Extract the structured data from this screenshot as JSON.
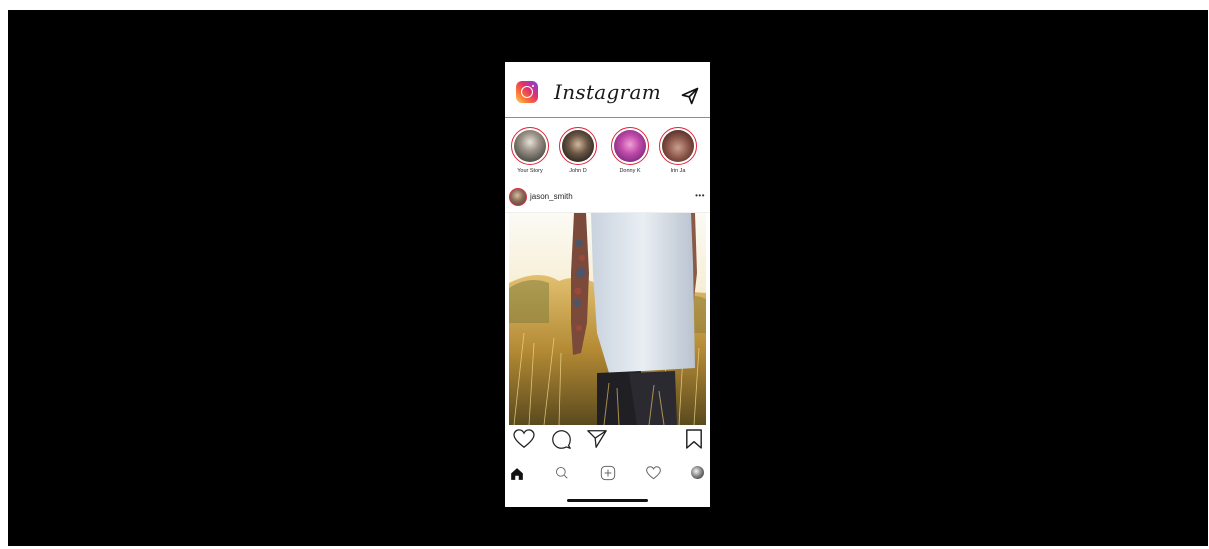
{
  "header": {
    "app_title": "Instagram"
  },
  "stories": [
    {
      "name": "Your Story"
    },
    {
      "name": "John D"
    },
    {
      "name": "Donny K"
    },
    {
      "name": "Irin Ja"
    }
  ],
  "post": {
    "username": "jason_smith",
    "more_label": "•••"
  },
  "icons": {
    "logo": "instagram-logo-icon",
    "direct": "paper-plane-icon",
    "like": "heart-outline-icon",
    "comment": "speech-bubble-icon",
    "share": "paper-plane-icon",
    "save": "bookmark-icon",
    "home": "home-filled-icon",
    "search": "search-icon",
    "new_post": "plus-square-icon",
    "activity": "heart-outline-icon",
    "profile": "profile-avatar-icon"
  },
  "colors": {
    "background": "#000000",
    "story_ring": "#e0243a",
    "text": "#262626"
  }
}
